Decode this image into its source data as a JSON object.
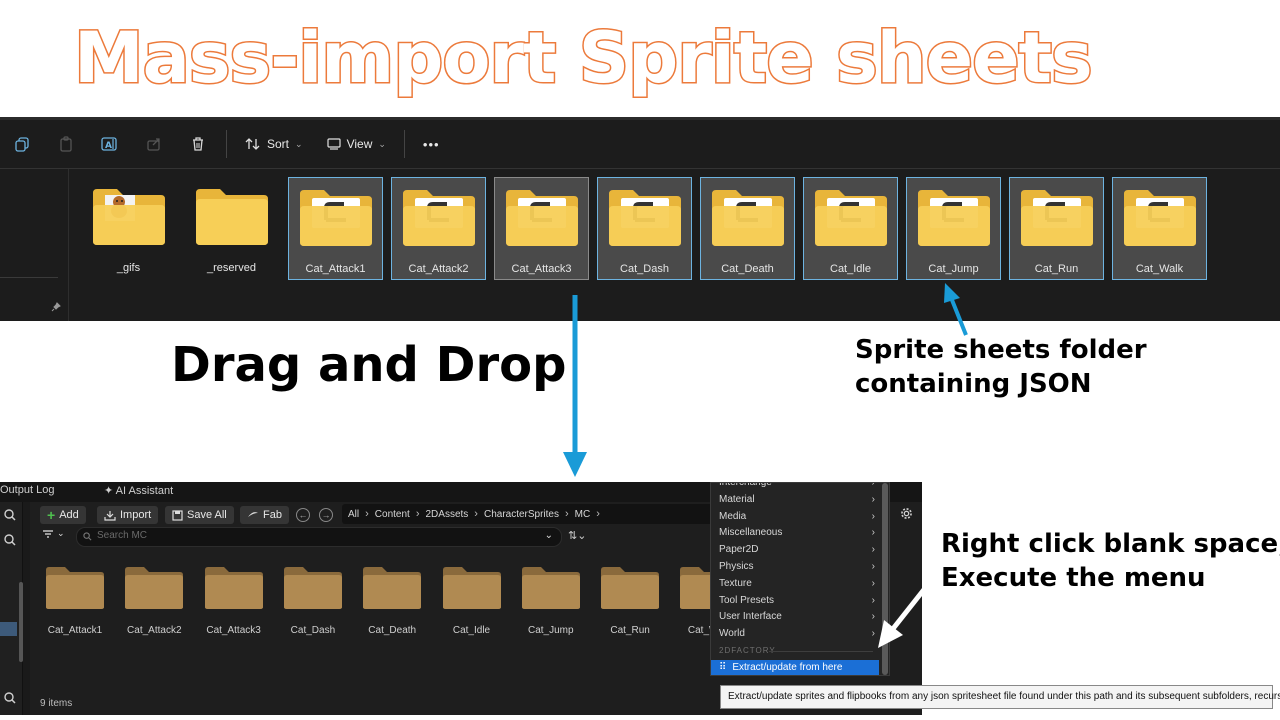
{
  "title": "Mass-import Sprite sheets",
  "explorer": {
    "toolbar": {
      "sort_label": "Sort",
      "view_label": "View",
      "more_label": "•••"
    },
    "folders": [
      {
        "name": "_gifs",
        "kind": "cat-thumb",
        "selected": false
      },
      {
        "name": "_reserved",
        "kind": "plain",
        "selected": false
      },
      {
        "name": "Cat_Attack1",
        "kind": "doc",
        "selected": true
      },
      {
        "name": "Cat_Attack2",
        "kind": "doc",
        "selected": true
      },
      {
        "name": "Cat_Attack3",
        "kind": "doc",
        "selected": true
      },
      {
        "name": "Cat_Dash",
        "kind": "doc",
        "selected": true
      },
      {
        "name": "Cat_Death",
        "kind": "doc",
        "selected": true
      },
      {
        "name": "Cat_Idle",
        "kind": "doc",
        "selected": true
      },
      {
        "name": "Cat_Jump",
        "kind": "doc",
        "selected": true
      },
      {
        "name": "Cat_Run",
        "kind": "doc",
        "selected": true
      },
      {
        "name": "Cat_Walk",
        "kind": "doc",
        "selected": true
      }
    ]
  },
  "annotations": {
    "drag_drop": "Drag and Drop",
    "sheet_note_line1": "Sprite sheets folder",
    "sheet_note_line2": "containing JSON",
    "right_click_line1": "Right click blank space,",
    "right_click_line2": "Execute the menu",
    "arrow_color": "#1a9bd7"
  },
  "unreal": {
    "tabs": {
      "output_log": "Output Log",
      "ai_assistant": "AI Assistant"
    },
    "buttons": {
      "add": "Add",
      "import": "Import",
      "save_all": "Save All",
      "fab": "Fab"
    },
    "breadcrumbs": [
      "All",
      "Content",
      "2DAssets",
      "CharacterSprites",
      "MC"
    ],
    "search_placeholder": "Search MC",
    "folders": [
      "Cat_Attack1",
      "Cat_Attack2",
      "Cat_Attack3",
      "Cat_Dash",
      "Cat_Death",
      "Cat_Idle",
      "Cat_Jump",
      "Cat_Run",
      "Cat_Walk"
    ],
    "status": "9 items"
  },
  "context_menu": {
    "items": [
      "Interchange",
      "Material",
      "Media",
      "Miscellaneous",
      "Paper2D",
      "Physics",
      "Texture",
      "Tool Presets",
      "User Interface",
      "World"
    ],
    "section": "2DFACTORY",
    "action": "Extract/update from here",
    "tooltip": "Extract/update sprites and flipbooks from any json spritesheet file found under this path and its subsequent subfolders, recursively."
  }
}
